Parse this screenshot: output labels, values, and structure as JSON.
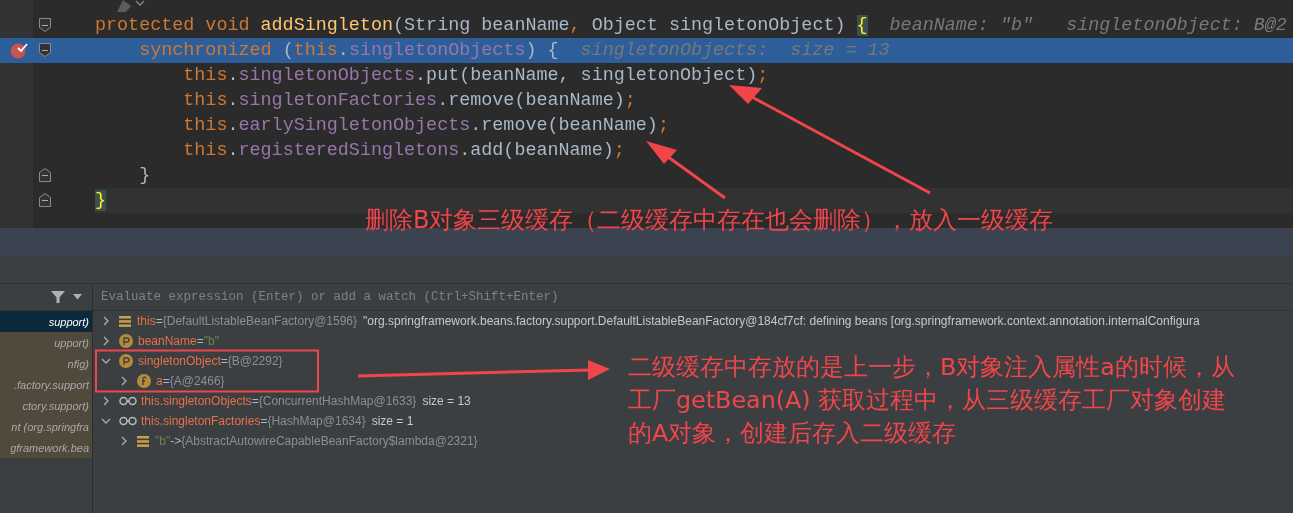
{
  "editor": {
    "lines": [
      {
        "highlighted": false,
        "breakpoint": false,
        "fold_start": true,
        "current": false,
        "tokens": [
          {
            "text": "protected void ",
            "kind": "keyword"
          },
          {
            "text": "addSingleton",
            "kind": "method"
          },
          {
            "text": "(String beanName",
            "kind": "plain"
          },
          {
            "text": ", ",
            "kind": "keyword"
          },
          {
            "text": "Object singletonObject) ",
            "kind": "plain"
          },
          {
            "text": "{",
            "kind": "match"
          }
        ],
        "hint": "beanName: \"b\"   singletonObject: B@2"
      },
      {
        "highlighted": true,
        "breakpoint": true,
        "fold_start": true,
        "current": false,
        "tokens": [
          {
            "text": "    synchronized ",
            "kind": "keyword"
          },
          {
            "text": "(",
            "kind": "plain"
          },
          {
            "text": "this",
            "kind": "keyword"
          },
          {
            "text": ".",
            "kind": "plain"
          },
          {
            "text": "singletonObjects",
            "kind": "field"
          },
          {
            "text": ") {",
            "kind": "plain"
          }
        ],
        "hint": "singletonObjects:  size = 13"
      },
      {
        "highlighted": false,
        "breakpoint": false,
        "current": false,
        "tokens": [
          {
            "text": "        this",
            "kind": "keyword"
          },
          {
            "text": ".",
            "kind": "plain"
          },
          {
            "text": "singletonObjects",
            "kind": "field"
          },
          {
            "text": ".put(beanName, singletonObject)",
            "kind": "plain"
          },
          {
            "text": ";",
            "kind": "keyword"
          }
        ]
      },
      {
        "highlighted": false,
        "breakpoint": false,
        "current": false,
        "tokens": [
          {
            "text": "        this",
            "kind": "keyword"
          },
          {
            "text": ".",
            "kind": "plain"
          },
          {
            "text": "singletonFactories",
            "kind": "field"
          },
          {
            "text": ".remove(beanName)",
            "kind": "plain"
          },
          {
            "text": ";",
            "kind": "keyword"
          }
        ]
      },
      {
        "highlighted": false,
        "breakpoint": false,
        "current": false,
        "tokens": [
          {
            "text": "        this",
            "kind": "keyword"
          },
          {
            "text": ".",
            "kind": "plain"
          },
          {
            "text": "earlySingletonObjects",
            "kind": "field"
          },
          {
            "text": ".remove(beanName)",
            "kind": "plain"
          },
          {
            "text": ";",
            "kind": "keyword"
          }
        ]
      },
      {
        "highlighted": false,
        "breakpoint": false,
        "current": false,
        "tokens": [
          {
            "text": "        this",
            "kind": "keyword"
          },
          {
            "text": ".",
            "kind": "plain"
          },
          {
            "text": "registeredSingletons",
            "kind": "field"
          },
          {
            "text": ".add(beanName)",
            "kind": "plain"
          },
          {
            "text": ";",
            "kind": "keyword"
          }
        ]
      },
      {
        "highlighted": false,
        "breakpoint": false,
        "fold_end": true,
        "current": false,
        "tokens": [
          {
            "text": "    }",
            "kind": "plain"
          }
        ]
      },
      {
        "highlighted": false,
        "breakpoint": false,
        "fold_end": true,
        "current": true,
        "tokens": [
          {
            "text": "}",
            "kind": "match"
          }
        ]
      }
    ]
  },
  "frames": [
    {
      "text": "support)",
      "selected": true
    },
    {
      "text": "upport)",
      "selected": false
    },
    {
      "text": "nfig)",
      "selected": false
    },
    {
      "text": ".factory.support",
      "selected": false
    },
    {
      "text": "ctory.support)",
      "selected": false
    },
    {
      "text": "nt (org.springfra",
      "selected": false
    },
    {
      "text": "gframework.bea",
      "selected": false
    }
  ],
  "evaluate": {
    "placeholder": "Evaluate expression (Enter) or add a watch (Ctrl+Shift+Enter)"
  },
  "variables": [
    {
      "kind": "list",
      "name": "this",
      "sep": " = ",
      "value": "{DefaultListableBeanFactory@1596}",
      "extra": "\"org.springframework.beans.factory.support.DefaultListableBeanFactory@184cf7cf: defining beans [org.springframework.context.annotation.internalConfigura",
      "expanded": false
    },
    {
      "kind": "param",
      "name": "beanName",
      "sep": " = ",
      "value": "\"b\"",
      "value_quoted": true,
      "expanded": false
    },
    {
      "kind": "param",
      "name": "singletonObject",
      "sep": " = ",
      "value": "{B@2292}",
      "expanded": true,
      "children": [
        {
          "kind": "field",
          "name": "a",
          "sep": " = ",
          "value": "{A@2466}",
          "expanded": false
        }
      ]
    },
    {
      "kind": "watch",
      "name": "this.singletonObjects",
      "sep": " = ",
      "value": "{ConcurrentHashMap@1633}",
      "extra": "size = 13",
      "expanded": false
    },
    {
      "kind": "watch",
      "name": "this.singletonFactories",
      "sep": " = ",
      "value": "{HashMap@1634}",
      "extra": "size = 1",
      "expanded": true,
      "children": [
        {
          "kind": "list",
          "name": "\"b\"",
          "name_quoted": true,
          "sep": " -> ",
          "value": "{AbstractAutowireCapableBeanFactory$lambda@2321}",
          "expanded": false
        }
      ]
    }
  ],
  "annotations": [
    "删除B对象三级缓存（二级缓存中存在也会删除），放入一级缓存",
    "二级缓存中存放的是上一步，B对象注入属性a的时候，从工厂getBean(A) 获取过程中，从三级缓存工厂对象创建的A对象，创建后存入二级缓存"
  ]
}
